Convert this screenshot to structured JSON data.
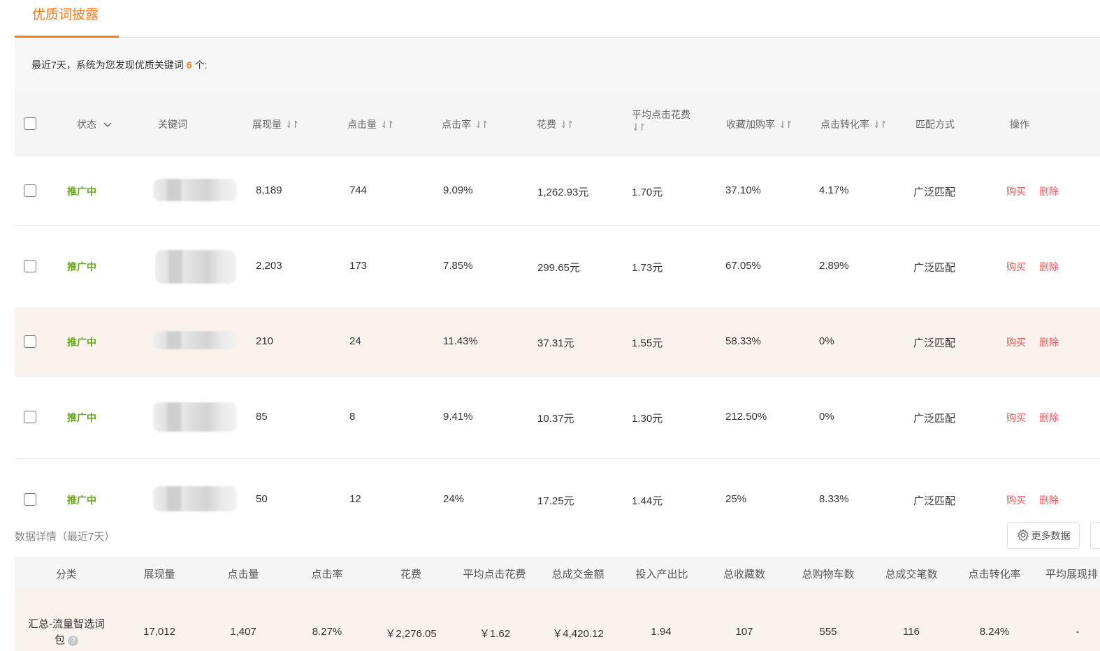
{
  "tab": {
    "label": "优质词披露"
  },
  "info": {
    "prefix": "最近7天，系统为您发现优质关键词",
    "count": "6",
    "suffix": "个:"
  },
  "keyword_table": {
    "headers": {
      "status": "状态",
      "keyword": "关键词",
      "impressions": "展现量",
      "clicks": "点击量",
      "ctr": "点击率",
      "cost": "花费",
      "avg_cpc_line1": "平均点击花费",
      "fav_cart_rate": "收藏加购率",
      "cvr": "点击转化率",
      "match": "匹配方式",
      "ops": "操作"
    },
    "rows": [
      {
        "status": "推广中",
        "impressions": "8,189",
        "clicks": "744",
        "ctr": "9.09%",
        "cost": "1,262.93元",
        "avg_cpc": "1.70元",
        "fav_cart_rate": "37.10%",
        "cvr": "4.17%",
        "match": "广泛匹配",
        "buy": "购买",
        "del": "删除"
      },
      {
        "status": "推广中",
        "impressions": "2,203",
        "clicks": "173",
        "ctr": "7.85%",
        "cost": "299.65元",
        "avg_cpc": "1.73元",
        "fav_cart_rate": "67.05%",
        "cvr": "2.89%",
        "match": "广泛匹配",
        "buy": "购买",
        "del": "删除"
      },
      {
        "status": "推广中",
        "impressions": "210",
        "clicks": "24",
        "ctr": "11.43%",
        "cost": "37.31元",
        "avg_cpc": "1.55元",
        "fav_cart_rate": "58.33%",
        "cvr": "0%",
        "match": "广泛匹配",
        "buy": "购买",
        "del": "删除"
      },
      {
        "status": "推广中",
        "impressions": "85",
        "clicks": "8",
        "ctr": "9.41%",
        "cost": "10.37元",
        "avg_cpc": "1.30元",
        "fav_cart_rate": "212.50%",
        "cvr": "0%",
        "match": "广泛匹配",
        "buy": "购买",
        "del": "删除"
      },
      {
        "status": "推广中",
        "impressions": "50",
        "clicks": "12",
        "ctr": "24%",
        "cost": "17.25元",
        "avg_cpc": "1.44元",
        "fav_cart_rate": "25%",
        "cvr": "8.33%",
        "match": "广泛匹配",
        "buy": "购买",
        "del": "删除"
      }
    ]
  },
  "details": {
    "title": "数据详情（最近7天）",
    "more_button": "更多数据",
    "headers": [
      "分类",
      "展现量",
      "点击量",
      "点击率",
      "花费",
      "平均点击花费",
      "总成交金额",
      "投入产出比",
      "总收藏数",
      "总购物车数",
      "总成交笔数",
      "点击转化率",
      "平均展现排"
    ],
    "summary": {
      "category_line1": "汇总-流量智选词",
      "category_line2": "包",
      "values": [
        "17,012",
        "1,407",
        "8.27%",
        "￥2,276.05",
        "￥1.62",
        "￥4,420.12",
        "1.94",
        "107",
        "555",
        "116",
        "8.24%",
        "-"
      ]
    }
  },
  "icons": {
    "sort": "sort-icon",
    "chevron": "chevron-down-icon",
    "gear": "gear-icon",
    "help": "question-icon"
  },
  "colors": {
    "accent": "#ff7a1a",
    "status_green": "#6aa51f",
    "action_red": "#f05a5a",
    "highlight_row": "#faf2ec"
  }
}
